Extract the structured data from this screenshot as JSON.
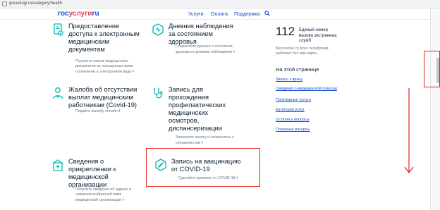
{
  "browser": {
    "url": "gosuslugi.ru/category/health"
  },
  "header": {
    "logo": {
      "gos": "гос",
      "uslugi": "услуги",
      "ru": "ru"
    },
    "nav": [
      "Услуги",
      "Оплата",
      "Поддержка"
    ]
  },
  "cards": [
    {
      "title": [
        "Предоставление",
        "доступа к электронным",
        "медицинским",
        "документам"
      ],
      "desc": [
        "Получите список медицинских",
        "документов из посещенных вами",
        "поликлиник в электронном виде"
      ],
      "icon": "document-check-icon"
    },
    {
      "title": [
        "Дневник наблюдения",
        "за состоянием",
        "здоровья"
      ],
      "desc": [
        "Сохраняйте данные о состоянии",
        "здоровья в дневник наблюдения"
      ],
      "icon": "diary-icon"
    },
    {
      "title": [
        "Жалоба об отсутствии",
        "выплат медицинским",
        "работникам (Covid-19)"
      ],
      "desc": [
        "Подайте жалобу онлайн"
      ],
      "icon": "doctor-icon"
    },
    {
      "title": [
        "Запись для",
        "прохождения",
        "профилактических",
        "медицинских",
        "осмотров,",
        "диспансеризации"
      ],
      "desc": [
        "Заполните анкету и запишитесь к",
        "специалистам"
      ],
      "icon": "stethoscope-icon"
    },
    {
      "title": [
        "Сведения о",
        "прикреплении к",
        "медицинской",
        "организации"
      ],
      "desc": [
        "Получите сведения об адресе и",
        "названии выбранной вами",
        "медицинской организации"
      ],
      "icon": "clinic-icon"
    },
    {
      "title": [
        "Запись на вакцинацию",
        "от COVID-19"
      ],
      "desc": [
        "Сделайте прививку от COVID-19"
      ],
      "icon": "syringe-icon"
    }
  ],
  "sidebar": {
    "number": "112",
    "number_text": [
      "Единый номер",
      "вызова экстренных",
      "служб"
    ],
    "number_sub": [
      "Бесплатно со всех телефонов,",
      "работает без сим-карты"
    ],
    "heading": "На этой странице",
    "links": [
      "Запись к врачу",
      "Сведения о медицинской помощи",
      "Популярные услуги",
      "Категории услуг",
      "Остались вопросы",
      "Полезные ресурсы"
    ]
  },
  "colors": {
    "accent": "#0d4cd3",
    "icon": "#00b6b0",
    "highlight": "#e1251b"
  }
}
